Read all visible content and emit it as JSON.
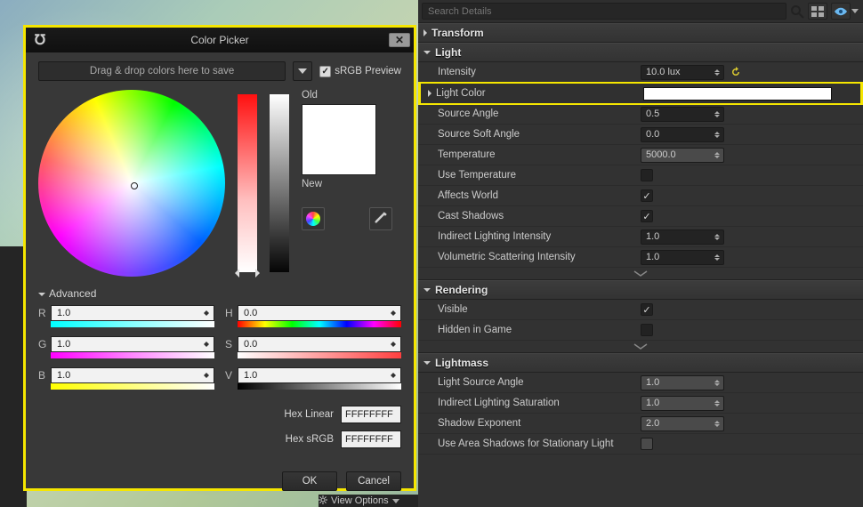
{
  "dialog": {
    "title": "Color Picker",
    "dropHint": "Drag & drop colors here to save",
    "srgbLabel": "sRGB Preview",
    "oldLabel": "Old",
    "newLabel": "New",
    "advancedLabel": "Advanced",
    "channels": {
      "r": {
        "letter": "R",
        "value": "1.0"
      },
      "g": {
        "letter": "G",
        "value": "1.0"
      },
      "b": {
        "letter": "B",
        "value": "1.0"
      },
      "h": {
        "letter": "H",
        "value": "0.0"
      },
      "s": {
        "letter": "S",
        "value": "0.0"
      },
      "v": {
        "letter": "V",
        "value": "1.0"
      }
    },
    "hexLinearLabel": "Hex Linear",
    "hexLinearValue": "FFFFFFFF",
    "hexSrgbLabel": "Hex sRGB",
    "hexSrgbValue": "FFFFFFFF",
    "okLabel": "OK",
    "cancelLabel": "Cancel"
  },
  "details": {
    "searchPlaceholder": "Search Details",
    "sections": {
      "transform": "Transform",
      "light": "Light",
      "rendering": "Rendering",
      "lightmass": "Lightmass"
    },
    "light": {
      "intensity": {
        "label": "Intensity",
        "value": "10.0 lux"
      },
      "lightColor": {
        "label": "Light Color"
      },
      "sourceAngle": {
        "label": "Source Angle",
        "value": "0.5"
      },
      "sourceSoftAngle": {
        "label": "Source Soft Angle",
        "value": "0.0"
      },
      "temperature": {
        "label": "Temperature",
        "value": "5000.0"
      },
      "useTemperature": {
        "label": "Use Temperature",
        "checked": false
      },
      "affectsWorld": {
        "label": "Affects World",
        "checked": true
      },
      "castShadows": {
        "label": "Cast Shadows",
        "checked": true
      },
      "indirectIntensity": {
        "label": "Indirect Lighting Intensity",
        "value": "1.0"
      },
      "volumetricScatter": {
        "label": "Volumetric Scattering Intensity",
        "value": "1.0"
      }
    },
    "rendering": {
      "visible": {
        "label": "Visible",
        "checked": true
      },
      "hiddenInGame": {
        "label": "Hidden in Game",
        "checked": false
      }
    },
    "lightmass": {
      "lightSourceAngle": {
        "label": "Light Source Angle",
        "value": "1.0"
      },
      "indirectSaturation": {
        "label": "Indirect Lighting Saturation",
        "value": "1.0"
      },
      "shadowExponent": {
        "label": "Shadow Exponent",
        "value": "2.0"
      },
      "useAreaShadows": {
        "label": "Use Area Shadows for Stationary Light",
        "checked": false
      }
    }
  },
  "viewOptionsLabel": "View Options"
}
